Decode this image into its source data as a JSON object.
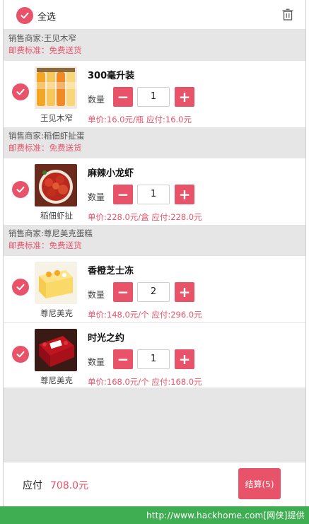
{
  "header": {
    "select_all_label": "全选",
    "icons": [
      "check-icon",
      "trash-icon"
    ]
  },
  "colors": {
    "accent": "#e8536a",
    "section_gray": "#e6e6e6",
    "watermark_green": "#3fae53"
  },
  "groups": [
    {
      "seller": "销售商家:王见木窄",
      "shipping": "邮费标准：免费送货",
      "item": {
        "shop": "王见木窄",
        "name": "300毫升装",
        "qty_label": "数量",
        "qty": "1",
        "price_text": "单价:16.0元/瓶 应付:16.0元",
        "minus": "−",
        "plus": "+"
      }
    },
    {
      "seller": "销售商家:稻佃虾扯蛋",
      "shipping": "邮费标准：免费送货",
      "item": {
        "shop": "稻佃虾扯",
        "name": "麻辣小龙虾",
        "qty_label": "数量",
        "qty": "1",
        "price_text": "单价:228.0元/盒 应付:228.0元",
        "minus": "−",
        "plus": "+"
      }
    },
    {
      "seller": "销售商家:尊尼美克蛋糕",
      "shipping": "邮费标准：免费送货",
      "items": [
        {
          "shop": "尊尼美克",
          "name": "香橙芝士冻",
          "qty_label": "数量",
          "qty": "2",
          "price_text": "单价:148.0元/个 应付:296.0元",
          "minus": "−",
          "plus": "+"
        },
        {
          "shop": "尊尼美克",
          "name": "时光之约",
          "qty_label": "数量",
          "qty": "1",
          "price_text": "单价:168.0元/个 应付:168.0元",
          "minus": "−",
          "plus": "+"
        }
      ]
    }
  ],
  "footer": {
    "total_label": "应付",
    "total_amount": "708.0元",
    "checkout_label": "结算(5)"
  },
  "watermark": "http://www.hackhome.com[网侠]提供"
}
